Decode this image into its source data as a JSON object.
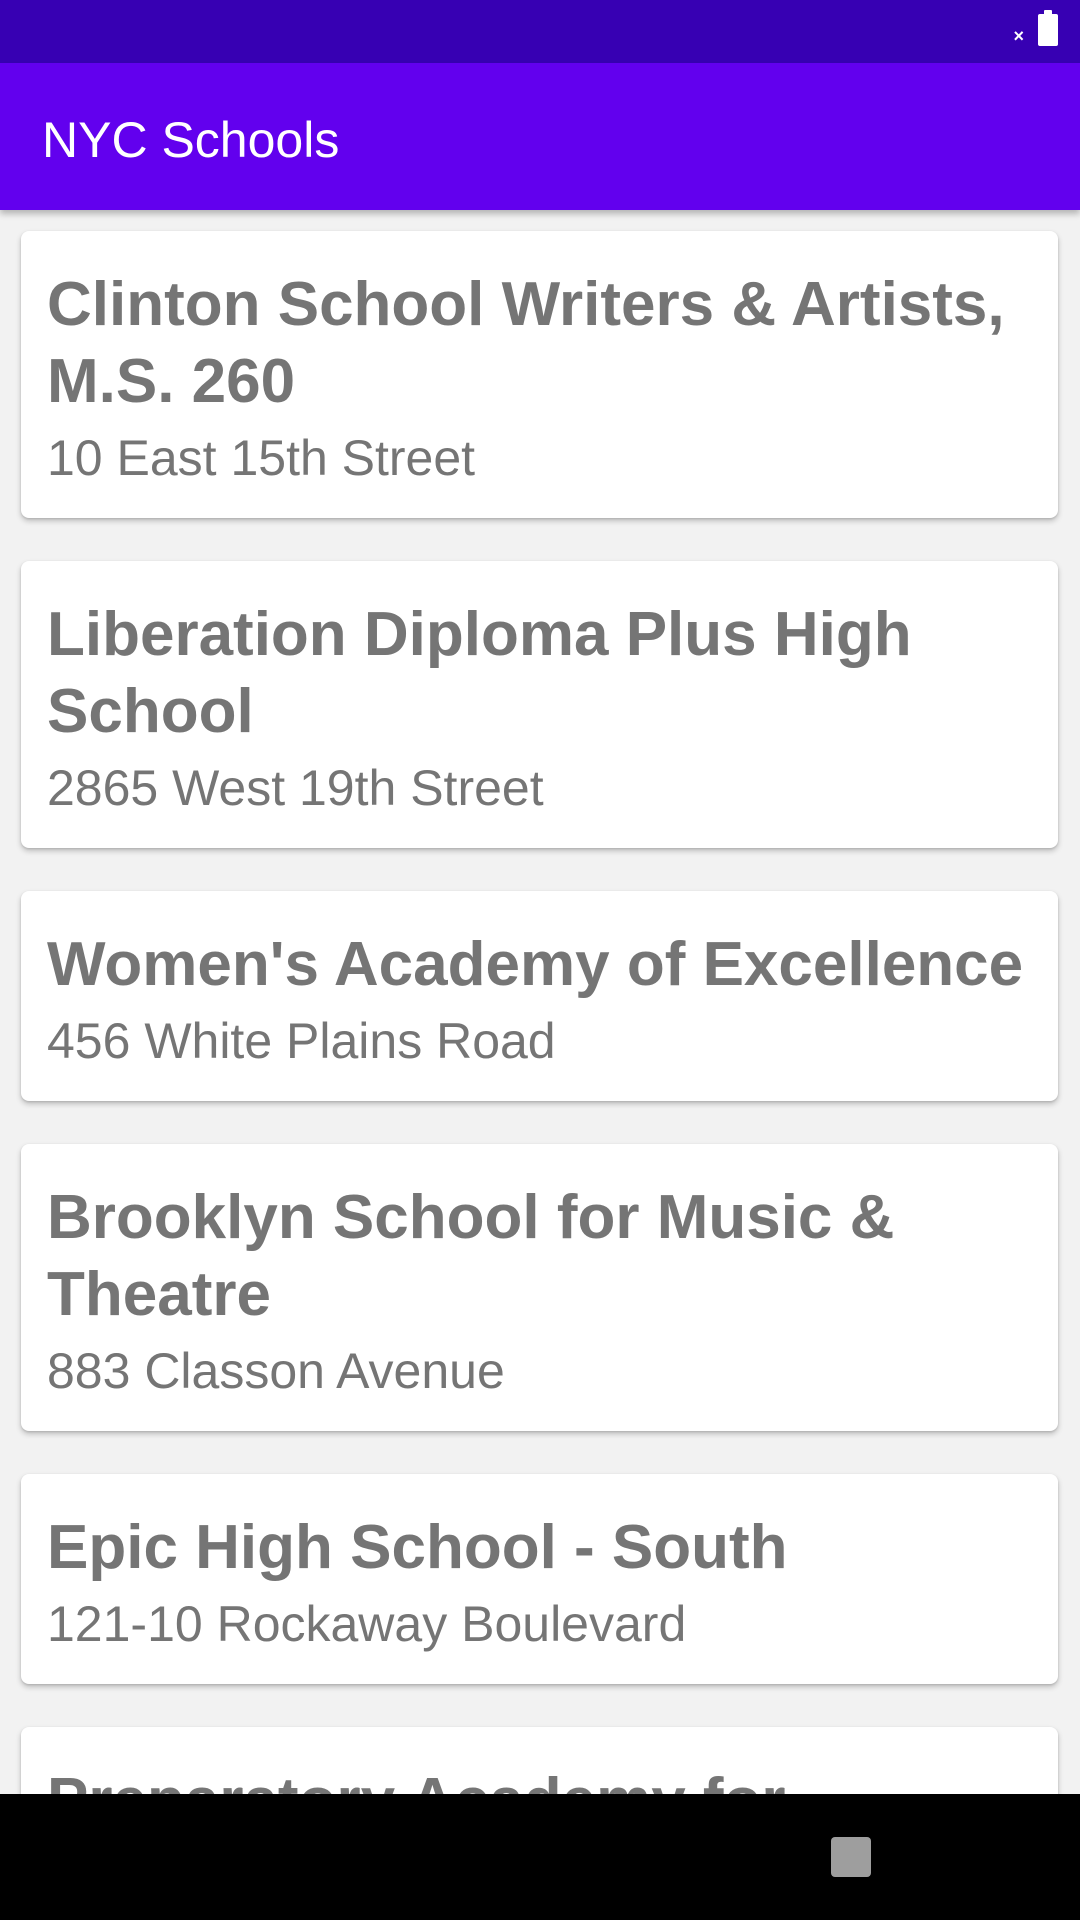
{
  "status_bar": {
    "signal_mark": "×",
    "battery_icon": "battery-icon",
    "background": "#3700b3"
  },
  "app_bar": {
    "title": "NYC Schools",
    "background": "#6200ee"
  },
  "schools": [
    {
      "name": "Clinton School Writers & Artists, M.S. 260",
      "address": "10 East 15th Street"
    },
    {
      "name": "Liberation Diploma Plus High School",
      "address": "2865 West 19th Street"
    },
    {
      "name": "Women's Academy of Excellence",
      "address": "456 White Plains Road"
    },
    {
      "name": "Brooklyn School for Music & Theatre",
      "address": "883 Classon Avenue"
    },
    {
      "name": "Epic High School - South",
      "address": "121-10 Rockaway Boulevard"
    },
    {
      "name": "Preparatory Academy for",
      "address": ""
    }
  ],
  "nav_bar": {
    "recents_icon": "recents-icon"
  },
  "colors": {
    "text_gray": "#757575",
    "card_bg": "#ffffff",
    "list_bg": "#f2f2f2"
  }
}
